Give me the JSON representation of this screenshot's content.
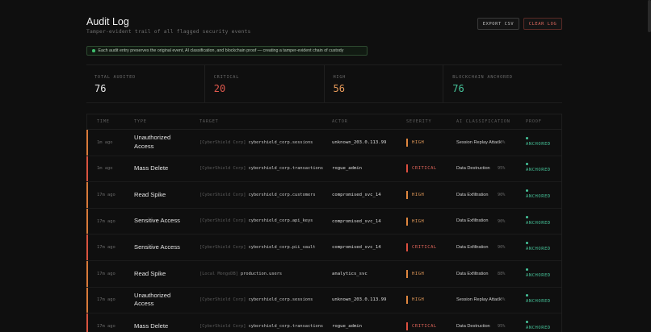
{
  "header": {
    "title": "Audit Log",
    "subtitle": "Tamper-evident trail of all flagged security events",
    "export_label": "EXPORT CSV",
    "clear_label": "CLEAR LOG"
  },
  "banner": {
    "text": "Each audit entry preserves the original event, AI classification, and blockchain proof — creating a tamper-evident chain of custody"
  },
  "stats": [
    {
      "label": "TOTAL AUDITED",
      "value": "76"
    },
    {
      "label": "CRITICAL",
      "value": "20"
    },
    {
      "label": "HIGH",
      "value": "56"
    },
    {
      "label": "BLOCKCHAIN ANCHORED",
      "value": "76"
    }
  ],
  "columns": [
    "TIME",
    "TYPE",
    "TARGET",
    "ACTOR",
    "SEVERITY",
    "AI CLASSIFICATION",
    "PROOF"
  ],
  "rows": [
    {
      "time": "1m ago",
      "type": "Unauthorized Access",
      "target_prefix": "[CyberShield Corp]",
      "target_name": "cybershield_corp.sessions",
      "actor": "unknown_203.0.113.99",
      "severity": "HIGH",
      "ai_class": "Session Replay Attack",
      "ai_pct": "90%",
      "proof": "ANCHORED"
    },
    {
      "time": "1m ago",
      "type": "Mass Delete",
      "target_prefix": "[CyberShield Corp]",
      "target_name": "cybershield_corp.transactions",
      "actor": "rogue_admin",
      "severity": "CRITICAL",
      "ai_class": "Data Destruction",
      "ai_pct": "95%",
      "proof": "ANCHORED"
    },
    {
      "time": "17m ago",
      "type": "Read Spike",
      "target_prefix": "[CyberShield Corp]",
      "target_name": "cybershield_corp.customers",
      "actor": "compromised_svc_14",
      "severity": "HIGH",
      "ai_class": "Data Exfiltration",
      "ai_pct": "90%",
      "proof": "ANCHORED"
    },
    {
      "time": "17m ago",
      "type": "Sensitive Access",
      "target_prefix": "[CyberShield Corp]",
      "target_name": "cybershield_corp.api_keys",
      "actor": "compromised_svc_14",
      "severity": "HIGH",
      "ai_class": "Data Exfiltration",
      "ai_pct": "90%",
      "proof": "ANCHORED"
    },
    {
      "time": "17m ago",
      "type": "Sensitive Access",
      "target_prefix": "[CyberShield Corp]",
      "target_name": "cybershield_corp.pii_vault",
      "actor": "compromised_svc_14",
      "severity": "CRITICAL",
      "ai_class": "Data Exfiltration",
      "ai_pct": "90%",
      "proof": "ANCHORED"
    },
    {
      "time": "17m ago",
      "type": "Read Spike",
      "target_prefix": "[Local MongoDB]",
      "target_name": "production.users",
      "actor": "analytics_svc",
      "severity": "HIGH",
      "ai_class": "Data Exfiltration",
      "ai_pct": "88%",
      "proof": "ANCHORED"
    },
    {
      "time": "17m ago",
      "type": "Unauthorized Access",
      "target_prefix": "[CyberShield Corp]",
      "target_name": "cybershield_corp.sessions",
      "actor": "unknown_203.0.113.99",
      "severity": "HIGH",
      "ai_class": "Session Replay Attack",
      "ai_pct": "90%",
      "proof": "ANCHORED"
    },
    {
      "time": "17m ago",
      "type": "Mass Delete",
      "target_prefix": "[CyberShield Corp]",
      "target_name": "cybershield_corp.transactions",
      "actor": "rogue_admin",
      "severity": "CRITICAL",
      "ai_class": "Data Destruction",
      "ai_pct": "95%",
      "proof": "ANCHORED"
    }
  ]
}
